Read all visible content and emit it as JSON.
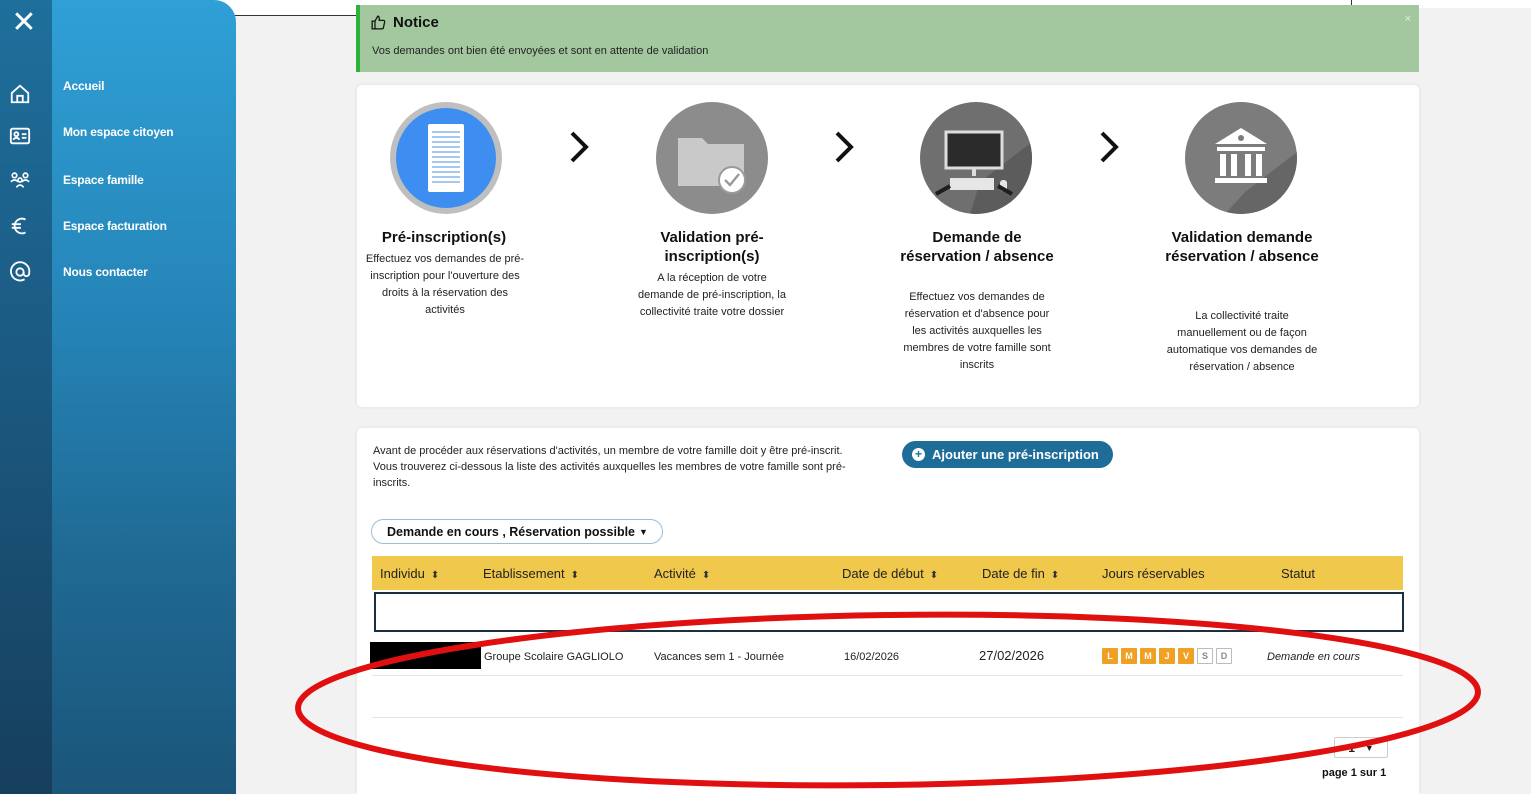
{
  "nav": {
    "items": [
      {
        "label": "Accueil",
        "icon": "home-icon"
      },
      {
        "label": "Mon espace citoyen",
        "icon": "id-card-icon"
      },
      {
        "label": "Espace famille",
        "icon": "family-icon"
      },
      {
        "label": "Espace facturation",
        "icon": "euro-icon"
      },
      {
        "label": "Nous contacter",
        "icon": "at-icon"
      }
    ]
  },
  "notice": {
    "title": "Notice",
    "text": "Vos demandes ont bien été envoyées et sont en attente de validation",
    "close": "×"
  },
  "steps": [
    {
      "title": "Pré-inscription(s)",
      "desc": "Effectuez vos demandes de pré-inscription pour l'ouverture des droits à la réservation des activités",
      "icon": "document-icon"
    },
    {
      "title": "Validation pré-inscription(s)",
      "desc": "A la réception de votre demande de pré-inscription, la collectivité traite votre dossier",
      "icon": "folder-check-icon"
    },
    {
      "title": "Demande de réservation / absence",
      "desc": "Effectuez vos demandes de réservation et d'absence pour les activités auxquelles les membres de votre famille sont inscrits",
      "icon": "computer-icon"
    },
    {
      "title": "Validation demande réservation / absence",
      "desc": "La collectivité traite manuellement ou de façon automatique vos demandes de réservation / absence",
      "icon": "building-icon"
    }
  ],
  "list": {
    "intro_line1": "Avant de procéder aux réservations d'activités, un membre de votre famille doit y être pré-inscrit.",
    "intro_line2": "Vous trouverez ci-dessous la liste des activités auxquelles les membres de votre famille sont pré-inscrits.",
    "add_button": "Ajouter une pré-inscription",
    "filter": "Demande en cours , Réservation possible",
    "headers": [
      "Individu",
      "Etablissement",
      "Activité",
      "Date de début",
      "Date de fin",
      "Jours réservables",
      "Statut"
    ],
    "rows": [
      {
        "etablissement": "Groupe Scolaire GAGLIOLO",
        "activite": "Vacances sem 1 - Journée",
        "date_debut": "16/02/2026",
        "date_fin": "27/02/2026",
        "jours": [
          {
            "l": "L",
            "on": true
          },
          {
            "l": "M",
            "on": true
          },
          {
            "l": "M",
            "on": true
          },
          {
            "l": "J",
            "on": true
          },
          {
            "l": "V",
            "on": true
          },
          {
            "l": "S",
            "on": false
          },
          {
            "l": "D",
            "on": false
          }
        ],
        "statut": "Demande en cours"
      }
    ],
    "page_select": "1",
    "page_info": "page 1 sur 1"
  },
  "colors": {
    "accent": "#1e6d98",
    "header_yellow": "#f0c84c",
    "day_on": "#f0a024",
    "notice_bg": "#a3c8a0",
    "annotation_red": "#e01010"
  }
}
